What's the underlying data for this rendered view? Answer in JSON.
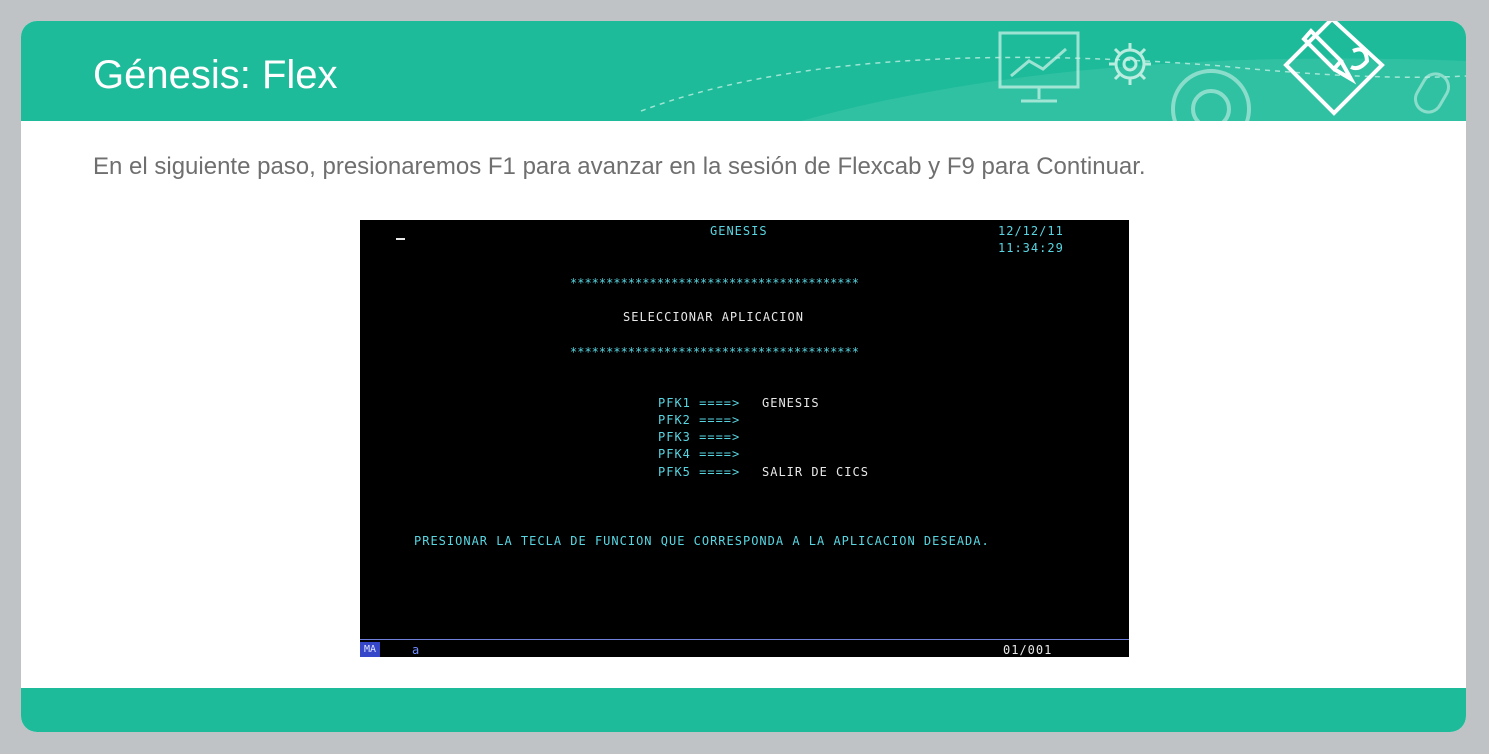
{
  "slide": {
    "title": "Génesis: Flex",
    "body": "En el siguiente paso, presionaremos F1 para avanzar en la sesión de Flexcab y F9 para Continuar."
  },
  "terminal": {
    "header": "GENESIS",
    "date": "12/12/11",
    "time": "11:34:29",
    "stars": "****************************************",
    "heading": "SELECCIONAR APLICACION",
    "pfk_lines": [
      {
        "key": "PFK1 ====>",
        "label": "GENESIS"
      },
      {
        "key": "PFK2 ====>",
        "label": ""
      },
      {
        "key": "PFK3 ====>",
        "label": ""
      },
      {
        "key": "PFK4 ====>",
        "label": ""
      },
      {
        "key": "PFK5 ====>",
        "label": "SALIR DE CICS"
      }
    ],
    "instruction": "PRESIONAR LA TECLA DE FUNCION QUE CORRESPONDA A LA APLICACION DESEADA.",
    "status": {
      "mode": "MA",
      "input": "a",
      "position": "01/001"
    }
  },
  "colors": {
    "accent": "#1dbb9a",
    "terminal_bg": "#000000",
    "terminal_cyan": "#58d6e2",
    "terminal_white": "#e8e8e8"
  },
  "icons": [
    "presentation-board-icon",
    "gear-icon",
    "large-gear-icon",
    "pencil-puzzle-icon",
    "mouse-icon"
  ]
}
